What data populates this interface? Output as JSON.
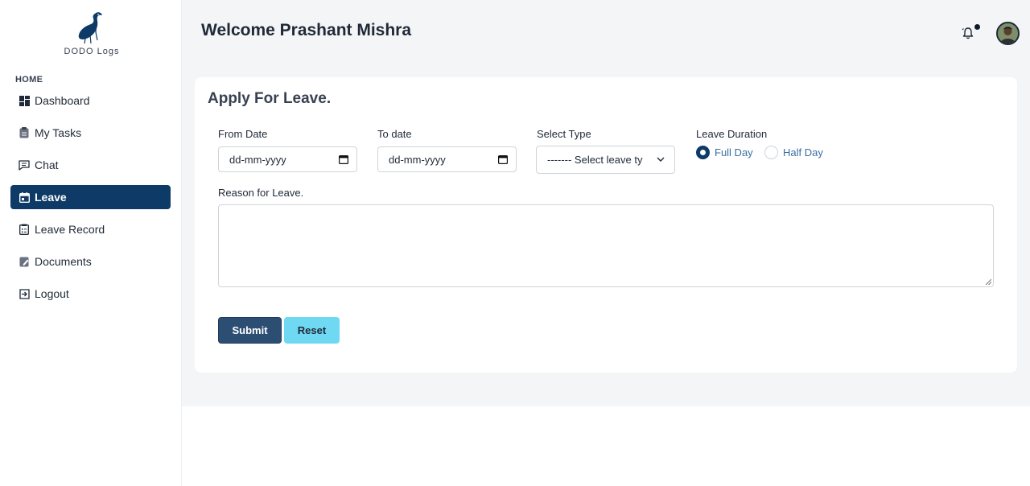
{
  "brand": {
    "name": "DODO Logs"
  },
  "sidebar": {
    "section_label": "HOME",
    "items": [
      {
        "label": "Dashboard",
        "icon": "dashboard-icon",
        "active": false
      },
      {
        "label": "My Tasks",
        "icon": "clipboard-icon",
        "active": false
      },
      {
        "label": "Chat",
        "icon": "chat-icon",
        "active": false
      },
      {
        "label": "Leave",
        "icon": "calendar-icon",
        "active": true
      },
      {
        "label": "Leave Record",
        "icon": "record-list-icon",
        "active": false
      },
      {
        "label": "Documents",
        "icon": "document-edit-icon",
        "active": false
      },
      {
        "label": "Logout",
        "icon": "logout-icon",
        "active": false
      }
    ]
  },
  "header": {
    "welcome": "Welcome Prashant Mishra",
    "notification_icon": "bell-icon",
    "avatar_icon": "user-avatar"
  },
  "form": {
    "title": "Apply For Leave.",
    "from_date": {
      "label": "From Date",
      "value": "dd-mm-yyyy"
    },
    "to_date": {
      "label": "To date",
      "value": "dd-mm-yyyy"
    },
    "leave_type": {
      "label": "Select Type",
      "value": "------- Select leave ty"
    },
    "duration": {
      "label": "Leave Duration",
      "options": [
        {
          "label": "Full Day",
          "checked": true
        },
        {
          "label": "Half Day",
          "checked": false
        }
      ]
    },
    "reason": {
      "label": "Reason for Leave.",
      "value": ""
    },
    "submit_label": "Submit",
    "reset_label": "Reset"
  },
  "colors": {
    "primary": "#0d3a66",
    "submit": "#2d4e73",
    "reset": "#6fd8f3",
    "background": "#f4f5f7"
  }
}
